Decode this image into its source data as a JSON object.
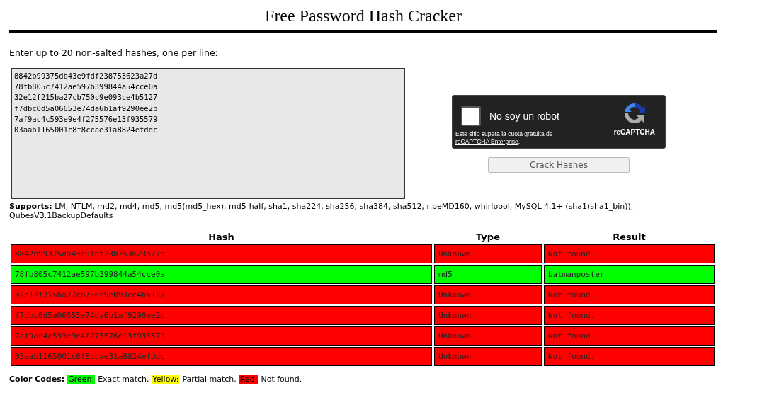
{
  "title": "Free Password Hash Cracker",
  "input": {
    "label": "Enter up to 20 non-salted hashes, one per line:",
    "value": "8842b99375db43e9fdf238753623a27d\n78fb805c7412ae597b399844a54cce0a\n32e12f215ba27cb750c9e093ce4b5127\nf7dbc0d5a06653e74da6b1af9290ee2b\n7af9ac4c593e9e4f275576e13f935579\n03aab1165001c8f8ccae31a8824efddc"
  },
  "captcha": {
    "checked": false,
    "label": "No soy un robot",
    "notice_prefix": "Este sitio supera la ",
    "notice_links": [
      "cuota gratuita de",
      "reCAPTCHA Enterprise"
    ],
    "notice_suffix": ".",
    "brand": "reCAPTCHA"
  },
  "submit": {
    "label": "Crack Hashes",
    "disabled": true
  },
  "supports": "**Supports:** LM, NTLM, md2, md4, md5, md5(md5_hex), md5-half, sha1, sha224, sha256, sha384, sha512, ripeMD160, whirlpool, MySQL 4.1+ (sha1(sha1_bin)), QubesV3.1BackupDefaults",
  "table": {
    "columns": [
      "Hash",
      "Type",
      "Result"
    ],
    "rows": [
      {
        "cells": [
          "8842b99375db43e9fdf238753623a27d",
          "Unknown",
          "Not found."
        ],
        "color": "#ff0000"
      },
      {
        "cells": [
          "78fb805c7412ae597b399844a54cce0a",
          "md5",
          "batmanposter"
        ],
        "color": "#00ff00"
      },
      {
        "cells": [
          "32e12f215ba27cb750c9e093ce4b5127",
          "Unknown",
          "Not found."
        ],
        "color": "#ff0000"
      },
      {
        "cells": [
          "f7dbc0d5a06653e74da6b1af9290ee2b",
          "Unknown",
          "Not found."
        ],
        "color": "#ff0000"
      },
      {
        "cells": [
          "7af9ac4c593e9e4f275576e13f935579",
          "Unknown",
          "Not found."
        ],
        "color": "#ff0000"
      },
      {
        "cells": [
          "03aab1165001c8f8ccae31a8824efddc",
          "Unknown",
          "Not found."
        ],
        "color": "#ff0000"
      }
    ]
  },
  "color_codes": {
    "label": "Color Codes:",
    "items": [
      {
        "name": "Green:",
        "meaning": "Exact match,",
        "color": "#00ff00"
      },
      {
        "name": "Yellow:",
        "meaning": "Partial match,",
        "color": "#ffff00"
      },
      {
        "name": "Red:",
        "meaning": "Not found.",
        "color": "#ff0000"
      }
    ]
  }
}
